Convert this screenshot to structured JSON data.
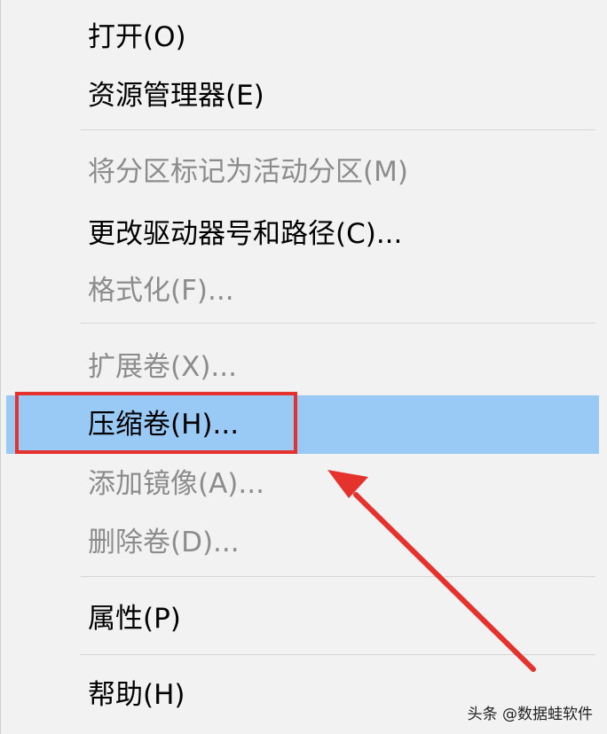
{
  "menu": {
    "items": [
      {
        "label": "打开(O)",
        "enabled": true
      },
      {
        "label": "资源管理器(E)",
        "enabled": true
      },
      {
        "label": "将分区标记为活动分区(M)",
        "enabled": false
      },
      {
        "label": "更改驱动器号和路径(C)...",
        "enabled": true
      },
      {
        "label": "格式化(F)...",
        "enabled": false
      },
      {
        "label": "扩展卷(X)...",
        "enabled": false
      },
      {
        "label": "压缩卷(H)...",
        "enabled": true,
        "highlighted": true
      },
      {
        "label": "添加镜像(A)...",
        "enabled": false
      },
      {
        "label": "删除卷(D)...",
        "enabled": false
      },
      {
        "label": "属性(P)",
        "enabled": true
      },
      {
        "label": "帮助(H)",
        "enabled": true
      }
    ]
  },
  "annotation": {
    "color": "#e5322d"
  },
  "colors": {
    "highlight": "#99c9f5",
    "background": "#f2f2f2",
    "disabled_text": "#8c8c8c"
  },
  "watermark": "头条 @数据蛙软件"
}
